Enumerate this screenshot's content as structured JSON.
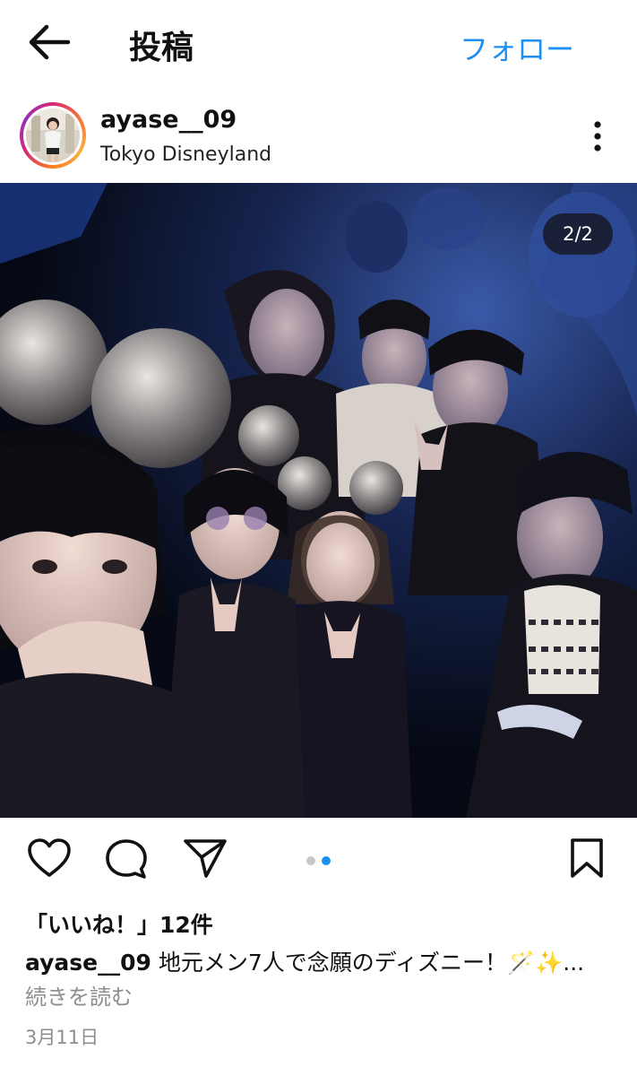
{
  "topbar": {
    "back_icon": "arrow-left-icon",
    "title": "投稿",
    "follow_label": "フォロー",
    "accent_color": "#1d8ff0"
  },
  "post": {
    "username": "ayase__09",
    "location": "Tokyo Disneyland",
    "more_icon": "more-vertical-icon",
    "carousel_counter": "2/2",
    "carousel": {
      "current": 2,
      "total": 2
    },
    "likes_text": "「いいね！」12件",
    "caption_text": "地元メン7人で念願のディズニー！🪄✨...",
    "read_more_label": "続きを読む",
    "date": "3月11日"
  },
  "actions": {
    "like_icon": "heart-icon",
    "comment_icon": "comment-icon",
    "share_icon": "send-icon",
    "save_icon": "bookmark-icon"
  },
  "colors": {
    "story_ring": [
      "#d62976",
      "#f77737",
      "#fcaf45",
      "#962fbf"
    ],
    "dot_active": "#1d8ff0",
    "dot_inactive": "#c7c7c7",
    "muted_text": "#8e8e8e"
  }
}
